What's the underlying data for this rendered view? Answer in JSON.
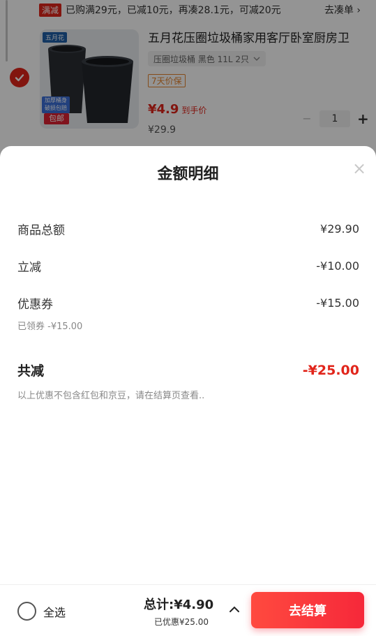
{
  "promo": {
    "tag": "满减",
    "text": "已购满29元，已减10元，再凑28.1元，可减20元",
    "link": "去凑单 ›"
  },
  "item": {
    "brand": "五月花",
    "title": "五月花压圈垃圾桶家用客厅卧室厨房卫",
    "spec": "压圈垃圾桶 黑色 11L 2只",
    "protect": "7天价保",
    "price": "¥4.9",
    "price_hint": "到手价",
    "original_price": "¥29.9",
    "quantity": "1",
    "badge_blue": "加厚桶身 破损包赔",
    "badge_red": "包邮"
  },
  "sheet": {
    "title": "金额明细",
    "rows": [
      {
        "label": "商品总额",
        "value": "¥29.90"
      },
      {
        "label": "立减",
        "value": "-¥10.00"
      },
      {
        "label": "优惠券",
        "value": "-¥15.00"
      }
    ],
    "coupon_note": "已领券 -¥15.00",
    "total": {
      "label": "共减",
      "value": "-¥25.00"
    },
    "disclaimer": "以上优惠不包含红包和京豆，请在结算页查看.."
  },
  "bottom_bar": {
    "select_all": "全选",
    "total": "总计:¥4.90",
    "saved": "已优惠¥25.00",
    "checkout": "去结算"
  },
  "colors": {
    "accent_red": "#e1251b",
    "checkout_button": "#f6283a",
    "protect_orange": "#e5832e"
  }
}
